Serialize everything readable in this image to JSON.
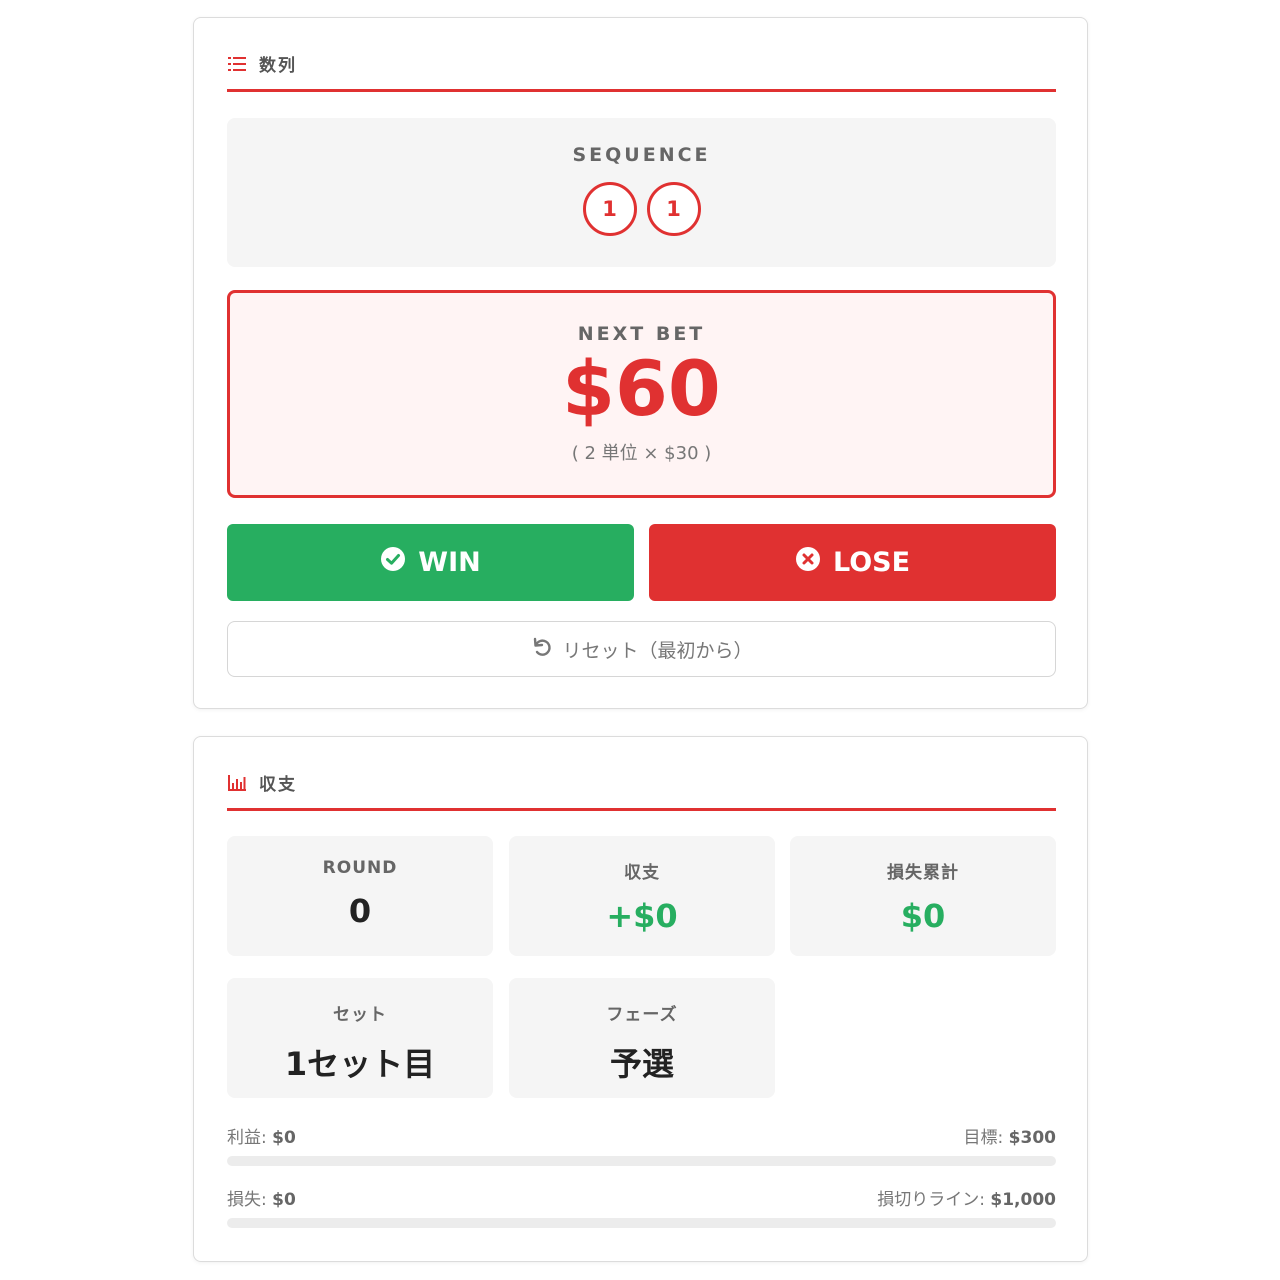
{
  "sequence_card": {
    "title": "数列",
    "sequence_label": "SEQUENCE",
    "sequence": [
      "1",
      "1"
    ],
    "next_bet_label": "NEXT BET",
    "next_bet_amount": "$60",
    "next_bet_detail": "( 2 単位 × $30 )",
    "win_label": "WIN",
    "lose_label": "LOSE",
    "reset_label": "リセット（最初から）"
  },
  "balance_card": {
    "title": "収支",
    "stats": {
      "round": {
        "label": "ROUND",
        "value": "0"
      },
      "balance": {
        "label": "収支",
        "value": "+$0"
      },
      "loss_total": {
        "label": "損失累計",
        "value": "$0"
      },
      "set": {
        "label": "セット",
        "value": "1セット目"
      },
      "phase": {
        "label": "フェーズ",
        "value": "予選"
      }
    },
    "profit_label": "利益:",
    "profit_value": "$0",
    "target_label": "目標:",
    "target_value": "$300",
    "profit_progress": 0,
    "loss_label": "損失:",
    "loss_value": "$0",
    "stoploss_label": "損切りライン:",
    "stoploss_value": "$1,000",
    "loss_progress": 0
  },
  "colors": {
    "accent_red": "#e03131",
    "win_green": "#27ae60"
  },
  "icons": {
    "sequence_header": "list-icon",
    "balance_header": "bar-chart-icon",
    "win": "check-circle-icon",
    "lose": "x-circle-icon",
    "reset": "undo-icon"
  }
}
